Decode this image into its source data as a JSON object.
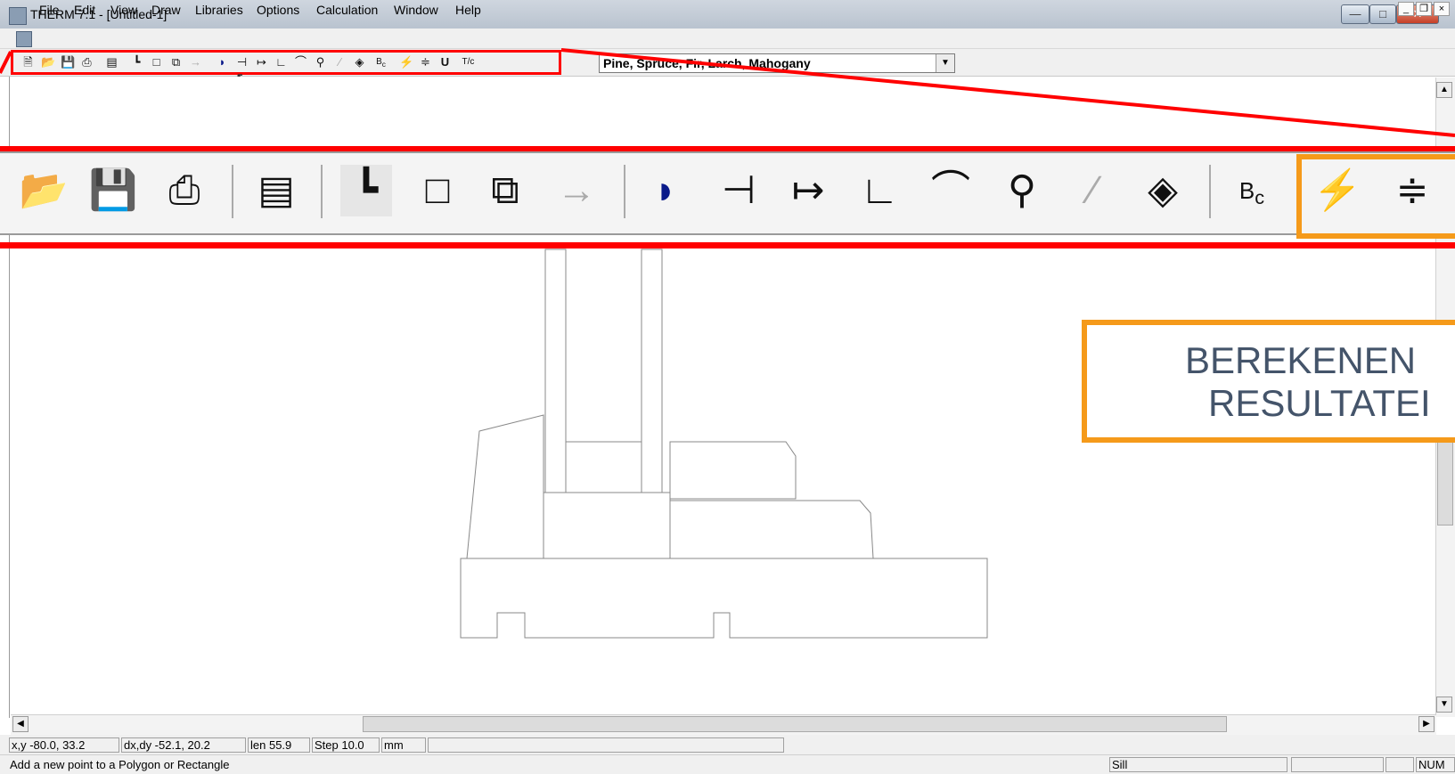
{
  "window": {
    "title": "THERM 7.1 - [Untitled-1]"
  },
  "menu": [
    "File",
    "Edit",
    "View",
    "Draw",
    "Libraries",
    "Options",
    "Calculation",
    "Window",
    "Help"
  ],
  "mdi_buttons": [
    "_",
    "❐",
    "×"
  ],
  "toolbar": {
    "material_select_value": "Pine, Spruce, Fir, Larch, Mahogany",
    "icons": [
      "new-file-icon",
      "open-folder-icon",
      "save-icon",
      "print-icon",
      "properties-icon",
      "polygon-icon",
      "rectangle-icon",
      "fill-void-icon",
      "insert-point-icon",
      "material-library-icon",
      "locate-point-icon",
      "move-point-icon",
      "draw-locator-icon",
      "arc-icon",
      "zoom-icon",
      "eyedropper-icon",
      "rotate-icon",
      "boundary-conditions-icon",
      "calculate-icon",
      "results-icon",
      "u-factor-icon",
      "text-callout-icon"
    ]
  },
  "zoomed_toolbar": {
    "icons": [
      "open-folder-icon",
      "save-icon",
      "print-icon",
      "properties-icon",
      "polygon-icon",
      "rectangle-icon",
      "fill-void-icon",
      "insert-point-icon",
      "material-library-icon",
      "locate-point-icon",
      "move-point-icon",
      "draw-locator-icon",
      "arc-icon",
      "zoom-icon",
      "eyedropper-icon",
      "rotate-icon",
      "boundary-conditions-icon",
      "calculate-icon",
      "results-icon"
    ]
  },
  "callout": {
    "line1": "BEREKENEN",
    "line2": "RESULTATEI"
  },
  "status": {
    "xy": "x,y -80.0, 33.2",
    "dxdy": "dx,dy -52.1, 20.2",
    "len": "len  55.9",
    "step": "Step  10.0",
    "unit": "mm",
    "message": "Add a new point to a Polygon or Rectangle",
    "mode": "Sill",
    "num": "NUM"
  },
  "colors": {
    "highlight_red": "#ff0000",
    "highlight_orange": "#f59a1a",
    "callout_text": "#44546a"
  }
}
